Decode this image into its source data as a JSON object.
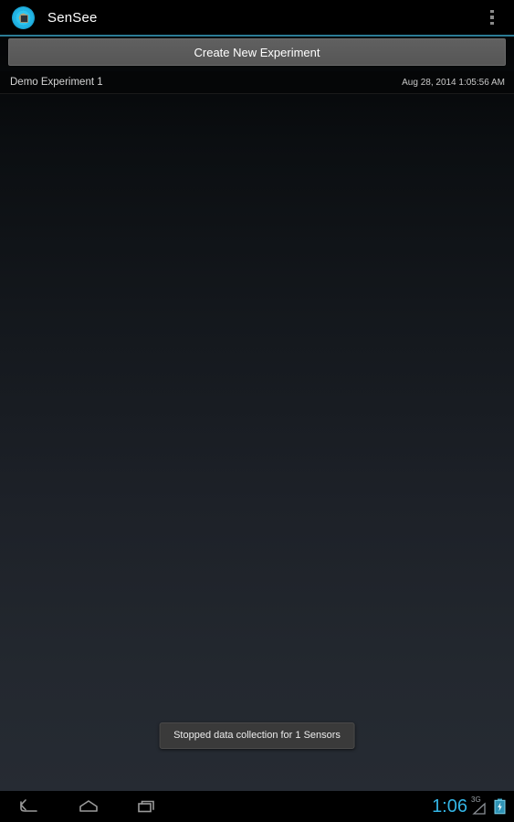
{
  "app": {
    "title": "SenSee",
    "icon": "app-logo-icon",
    "accent_color": "#33b5e5",
    "divider_color": "#2b7b94"
  },
  "action_bar": {
    "overflow_label": "More options"
  },
  "main": {
    "create_button_label": "Create New Experiment",
    "experiments": [
      {
        "name": "Demo Experiment 1",
        "date": "Aug 28, 2014 1:05:56 AM"
      }
    ]
  },
  "toast": {
    "message": "Stopped data collection for 1 Sensors"
  },
  "nav_bar": {
    "back_icon": "back-icon",
    "home_icon": "home-icon",
    "recents_icon": "recents-icon"
  },
  "status_bar": {
    "clock": "1:06",
    "network": "3G",
    "battery_icon": "battery-charging-icon",
    "clock_color": "#33b5e5"
  }
}
